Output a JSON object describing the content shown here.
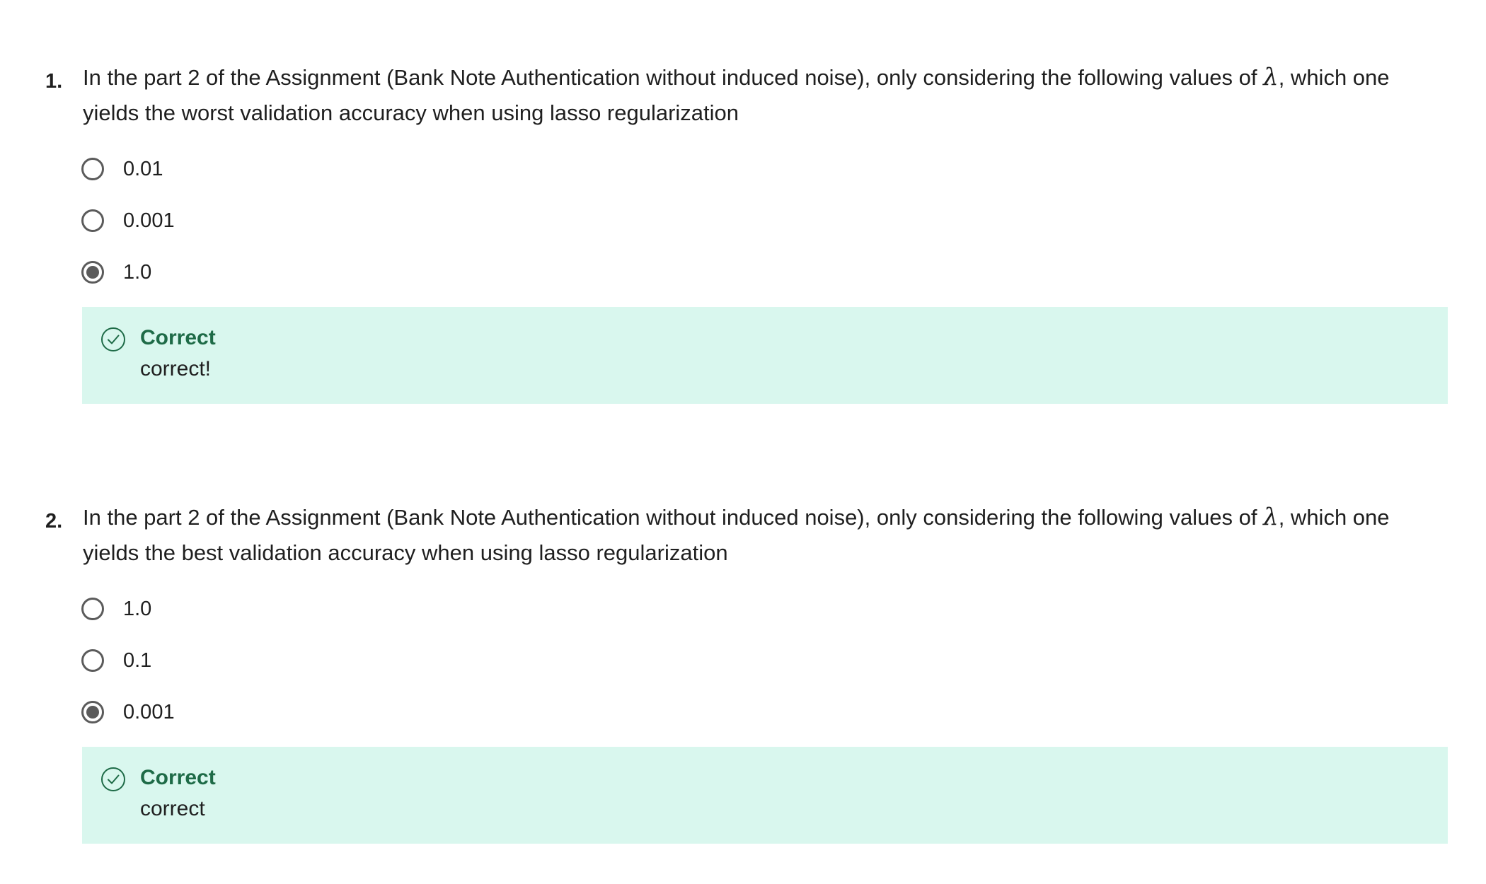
{
  "questions": [
    {
      "number": "1.",
      "text_before": "In the part 2 of the Assignment (Bank Note Authentication without induced noise), only considering the following values of ",
      "symbol": "λ",
      "text_after": ", which one yields the worst validation accuracy when using lasso regularization",
      "options": [
        {
          "label": "0.01",
          "selected": false
        },
        {
          "label": "0.001",
          "selected": false
        },
        {
          "label": "1.0",
          "selected": true
        }
      ],
      "feedback": {
        "status": "Correct",
        "message": "correct!"
      }
    },
    {
      "number": "2.",
      "text_before": "In the part 2 of the Assignment (Bank Note Authentication without induced noise), only considering the following values of ",
      "symbol": "λ",
      "text_after": ", which one yields the best validation accuracy when using lasso regularization",
      "options": [
        {
          "label": "1.0",
          "selected": false
        },
        {
          "label": "0.1",
          "selected": false
        },
        {
          "label": "0.001",
          "selected": true
        }
      ],
      "feedback": {
        "status": "Correct",
        "message": "correct"
      }
    }
  ],
  "colors": {
    "feedback_bg": "#d9f7ee",
    "feedback_title": "#1e6b47",
    "radio": "#5b5b5b",
    "text": "#1f1f1f"
  },
  "icons": {
    "feedback": "check-circle-icon"
  }
}
